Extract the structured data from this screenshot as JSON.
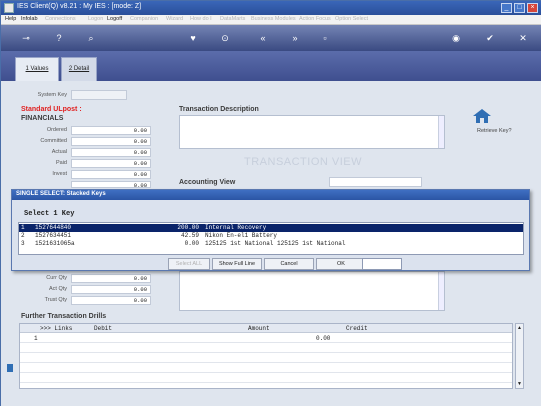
{
  "window": {
    "title": "IES Client(Q) v8.21 : My IES :      [mode: Z]",
    "controls": [
      "_",
      "□",
      "×"
    ]
  },
  "menu": [
    {
      "label": "Help",
      "enabled": true
    },
    {
      "label": "Infolab",
      "enabled": true
    },
    {
      "label": "Connections",
      "enabled": false
    },
    {
      "label": "Logon",
      "enabled": false
    },
    {
      "label": "Logoff",
      "enabled": true
    },
    {
      "label": "Companion",
      "enabled": false
    },
    {
      "label": "Wizard",
      "enabled": false
    },
    {
      "label": "How do I",
      "enabled": false
    },
    {
      "label": "DataMarts",
      "enabled": false
    },
    {
      "label": "Business Modules",
      "enabled": false
    },
    {
      "label": "Action Focus",
      "enabled": false
    },
    {
      "label": "Option Select",
      "enabled": false
    }
  ],
  "tabs": [
    {
      "label": "1 Values",
      "active": true
    },
    {
      "label": "2 Detail",
      "active": false
    }
  ],
  "form": {
    "system_key_label": "System Key",
    "title": "Standard ULpost :",
    "financials_header": "FINANCIALS",
    "financials": [
      {
        "label": "Ordered",
        "value": "0.00"
      },
      {
        "label": "Committed",
        "value": "0.00"
      },
      {
        "label": "Actual",
        "value": "0.00"
      },
      {
        "label": "Paid",
        "value": "0.00"
      },
      {
        "label": "Invest",
        "value": "0.00"
      },
      {
        "label": "",
        "value": "0.00"
      }
    ],
    "lower_fields": [
      {
        "label": "Curr Qty",
        "value": "0.00"
      },
      {
        "label": "Act Qty",
        "value": "0.00"
      },
      {
        "label": "Trust Qty",
        "value": "0.00"
      }
    ],
    "transaction_description_header": "Transaction Description",
    "watermark": "TRANSACTION VIEW",
    "accounting_view_header": "Accounting View",
    "retrieve_key_label": "Retrieve Key?"
  },
  "dialog": {
    "title": "SINGLE SELECT: Stacked Keys",
    "heading": "Select 1 Key",
    "rows": [
      {
        "num": "1",
        "key": "1527644840",
        "amount": "200.00",
        "desc": "Internal Recovery",
        "selected": true
      },
      {
        "num": "2",
        "key": "1527634451",
        "amount": "42.59",
        "desc": "Nikon En-el1 Battery",
        "selected": false
      },
      {
        "num": "3",
        "key": "1521631065a",
        "amount": "0.00",
        "desc": "125125 1st National 125125 1st National",
        "selected": false
      }
    ],
    "buttons": {
      "select_all": "Select ALL",
      "show_full_line": "Show Full Line",
      "cancel": "Cancel",
      "ok": "OK"
    },
    "input_value": ""
  },
  "drills": {
    "header": "Further Transaction Drills",
    "columns": [
      ">>> Links",
      "Debit",
      "Amount",
      "Credit"
    ],
    "rows": [
      {
        "num": "1",
        "amount": "0.00"
      }
    ]
  }
}
